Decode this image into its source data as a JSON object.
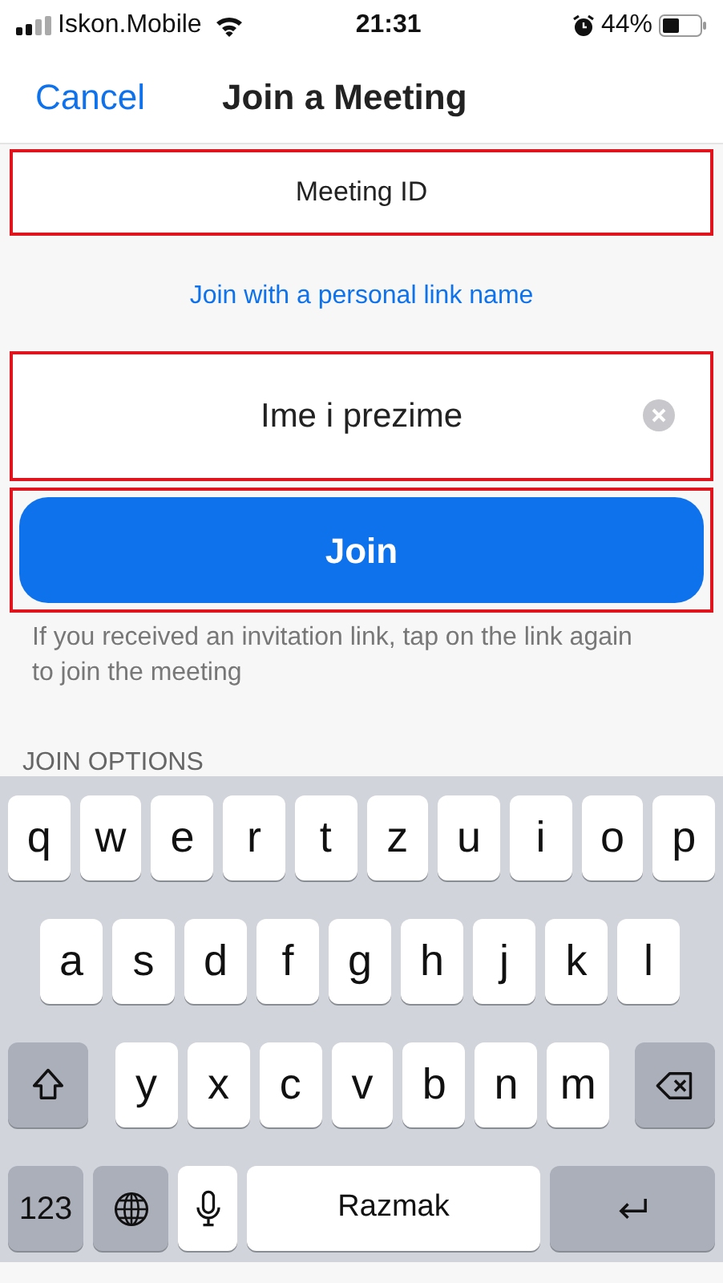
{
  "status_bar": {
    "carrier": "Iskon.Mobile",
    "time": "21:31",
    "battery": "44%"
  },
  "nav": {
    "cancel": "Cancel",
    "title": "Join a Meeting"
  },
  "meeting_id": {
    "placeholder": "Meeting ID",
    "highlighted": true
  },
  "personal_link": "Join with a personal link name",
  "name_field": {
    "value": "Ime i prezime",
    "highlighted": true
  },
  "join_button": {
    "label": "Join",
    "highlighted": true
  },
  "hint": "If you received an invitation link, tap on the link again to join the meeting",
  "section_heading": "JOIN OPTIONS",
  "keyboard": {
    "letter_rows": [
      [
        {
          "kind": "letter",
          "label": "q"
        },
        {
          "kind": "letter",
          "label": "w"
        },
        {
          "kind": "letter",
          "label": "e"
        },
        {
          "kind": "letter",
          "label": "r"
        },
        {
          "kind": "letter",
          "label": "t"
        },
        {
          "kind": "letter",
          "label": "z"
        },
        {
          "kind": "letter",
          "label": "u"
        },
        {
          "kind": "letter",
          "label": "i"
        },
        {
          "kind": "letter",
          "label": "o"
        },
        {
          "kind": "letter",
          "label": "p"
        }
      ],
      [
        {
          "kind": "letter",
          "label": "a"
        },
        {
          "kind": "letter",
          "label": "s"
        },
        {
          "kind": "letter",
          "label": "d"
        },
        {
          "kind": "letter",
          "label": "f"
        },
        {
          "kind": "letter",
          "label": "g"
        },
        {
          "kind": "letter",
          "label": "h"
        },
        {
          "kind": "letter",
          "label": "j"
        },
        {
          "kind": "letter",
          "label": "k"
        },
        {
          "kind": "letter",
          "label": "l"
        }
      ],
      [
        {
          "kind": "shift"
        },
        {
          "kind": "letter",
          "label": "y"
        },
        {
          "kind": "letter",
          "label": "x"
        },
        {
          "kind": "letter",
          "label": "c"
        },
        {
          "kind": "letter",
          "label": "v"
        },
        {
          "kind": "letter",
          "label": "b"
        },
        {
          "kind": "letter",
          "label": "n"
        },
        {
          "kind": "letter",
          "label": "m"
        },
        {
          "kind": "delete"
        }
      ]
    ],
    "bottom_row": [
      {
        "kind": "numbers",
        "label": "123"
      },
      {
        "kind": "globe"
      },
      {
        "kind": "mic"
      },
      {
        "kind": "space",
        "label": "Razmak"
      },
      {
        "kind": "return"
      }
    ]
  }
}
